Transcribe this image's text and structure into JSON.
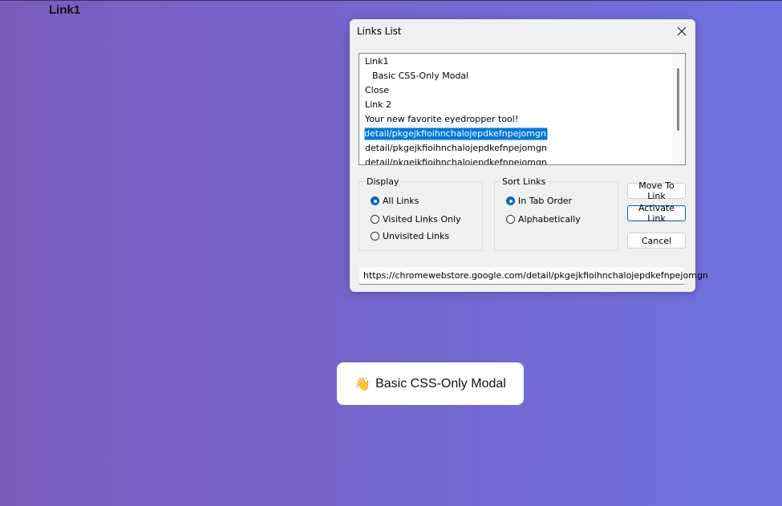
{
  "page": {
    "top_link": "Link1",
    "modal_button_emoji": "👋",
    "modal_button_label": "Basic CSS-Only Modal"
  },
  "dialog": {
    "title": "Links List",
    "close_icon": "close-icon",
    "list_items": [
      "Link1",
      "  Basic CSS-Only Modal",
      "Close",
      "Link 2",
      "Your new favorite eyedropper tool!",
      "detail/pkgejkfioihnchalojepdkefnpejomgn",
      "detail/pkgejkfioihnchalojepdkefnpejomgn",
      "detail/pkgejkfioihnchalojepdkefnpejomgn"
    ],
    "selected_index": 5,
    "display_group": {
      "legend": "Display",
      "options": [
        "All Links",
        "Visited Links Only",
        "Unvisited Links"
      ],
      "selected": "All Links"
    },
    "sort_group": {
      "legend": "Sort Links",
      "options": [
        "In Tab Order",
        "Alphabetically"
      ],
      "selected": "In Tab Order"
    },
    "buttons": {
      "move": "Move To Link",
      "activate": "Activate Link",
      "cancel": "Cancel"
    },
    "url": "https://chromewebstore.google.com/detail/pkgejkfioihnchalojepdkefnpejomgn"
  },
  "colors": {
    "accent": "#0067c0",
    "selection": "#0078d7",
    "gradient_start": "#7b5cbb",
    "gradient_end": "#6f73e0"
  }
}
